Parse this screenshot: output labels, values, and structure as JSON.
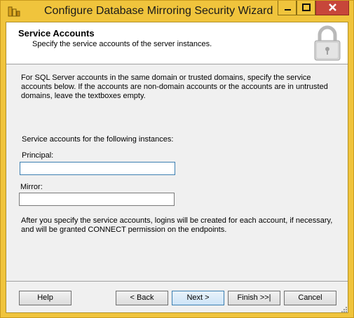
{
  "window": {
    "title": "Configure Database Mirroring Security Wizard"
  },
  "header": {
    "title": "Service Accounts",
    "subtitle": "Specify the service accounts of the server instances."
  },
  "content": {
    "intro": "For SQL Server accounts in the same domain or trusted domains, specify the service accounts below. If the accounts are non-domain accounts or the accounts are in untrusted domains, leave the textboxes empty.",
    "instances_label": "Service accounts for the following instances:",
    "principal_label": "Principal:",
    "principal_value": "",
    "mirror_label": "Mirror:",
    "mirror_value": "",
    "footer_note": "After you specify the service accounts, logins will be created for each account, if necessary, and will be granted CONNECT permission on the endpoints."
  },
  "buttons": {
    "help": "Help",
    "back": "< Back",
    "next": "Next >",
    "finish": "Finish >>|",
    "cancel": "Cancel"
  },
  "icons": {
    "app": "sql-server-icon",
    "header": "lock-icon",
    "minimize": "minimize-icon",
    "maximize": "maximize-icon",
    "close": "close-icon"
  },
  "colors": {
    "titlebar": "#f0c43c",
    "close_button": "#c7463a",
    "client_background": "#f0f0f0",
    "focus_border": "#3c7fb1"
  }
}
